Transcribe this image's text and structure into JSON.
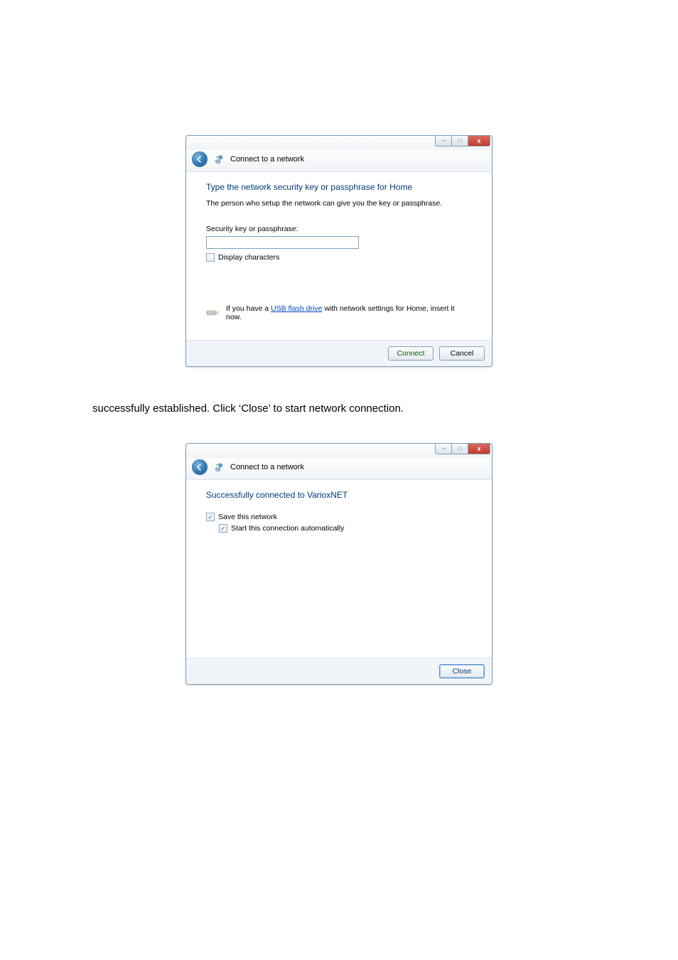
{
  "caption_text": "successfully established. Click ‘Close’ to start network connection.",
  "window_controls": {
    "min": "–",
    "max": "□",
    "close": "x"
  },
  "dialog1": {
    "header_title": "Connect to a network",
    "instruction_main": "Type the network security key or passphrase for Home",
    "instruction_sub": "The person who setup the network can give you the key or passphrase.",
    "field_label": "Security key or passphrase:",
    "input_value": "",
    "display_characters_label": "Display characters",
    "display_characters_checked": false,
    "usb_text_pre": "If you have a ",
    "usb_link_text": "USB flash drive",
    "usb_text_post": " with network settings for Home, insert it now.",
    "connect_label": "Connect",
    "cancel_label": "Cancel"
  },
  "dialog2": {
    "header_title": "Connect to a network",
    "instruction_main": "Successfully connected to VarioxNET",
    "save_network_label": "Save this network",
    "save_network_checked": true,
    "auto_start_label": "Start this connection automatically",
    "auto_start_checked": true,
    "close_label": "Close"
  }
}
